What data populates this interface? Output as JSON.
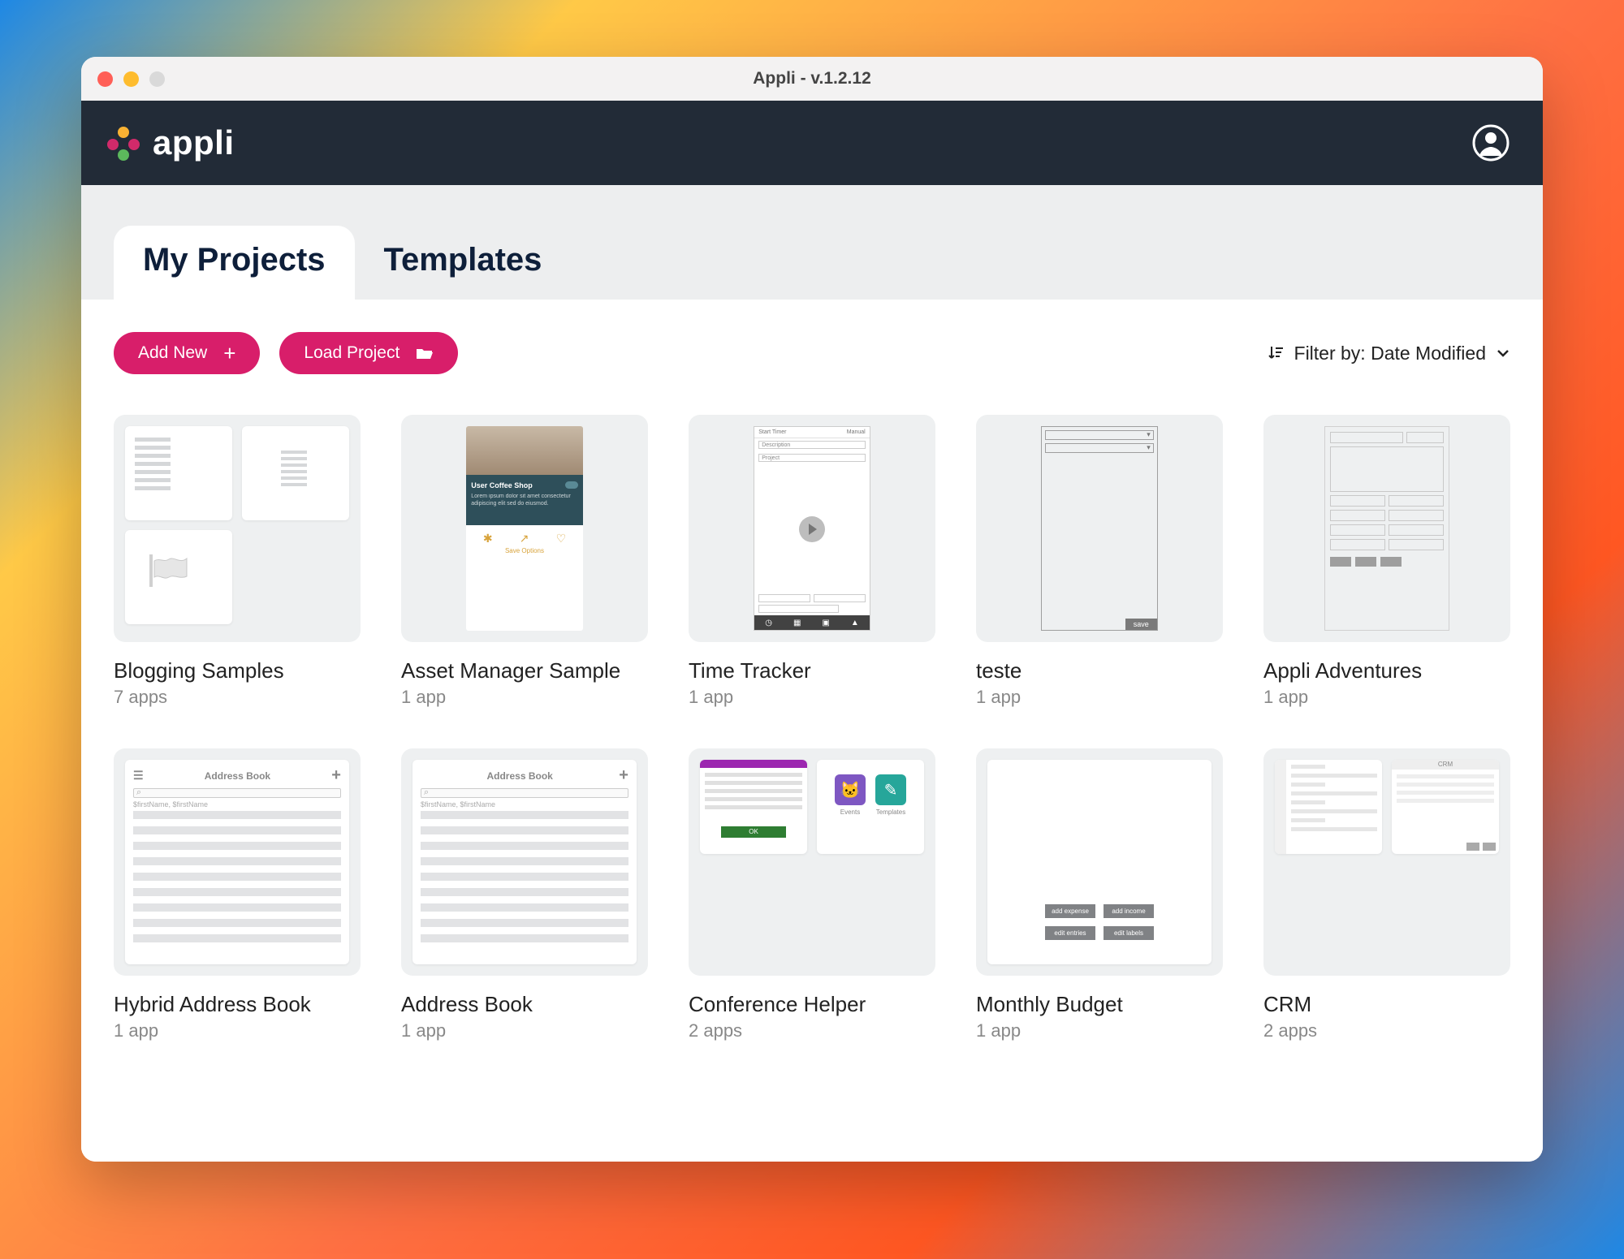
{
  "window": {
    "title": "Appli - v.1.2.12"
  },
  "brand": {
    "name": "appli"
  },
  "tabs": {
    "my_projects": "My Projects",
    "templates": "Templates"
  },
  "toolbar": {
    "add_new": "Add New",
    "load_project": "Load Project",
    "filter_label": "Filter by: Date Modified"
  },
  "thumb_text": {
    "asset_manager_title": "User Coffee Shop",
    "asset_manager_sublabel": "Save Options",
    "time_tracker_field1": "Description",
    "time_tracker_field2": "Project",
    "teste_save": "save",
    "address_book_header": "Address Book",
    "hybrid_icon": "☰",
    "conference_events": "Events",
    "conference_templates": "Templates",
    "crm_header": "CRM"
  },
  "projects": [
    {
      "title": "Blogging Samples",
      "sub": "7 apps"
    },
    {
      "title": "Asset Manager Sample",
      "sub": "1 app"
    },
    {
      "title": "Time Tracker",
      "sub": "1 app"
    },
    {
      "title": "teste",
      "sub": "1 app"
    },
    {
      "title": "Appli Adventures",
      "sub": "1 app"
    },
    {
      "title": "Hybrid Address Book",
      "sub": "1 app"
    },
    {
      "title": "Address Book",
      "sub": "1 app"
    },
    {
      "title": "Conference Helper",
      "sub": "2 apps"
    },
    {
      "title": "Monthly Budget",
      "sub": "1 app"
    },
    {
      "title": "CRM",
      "sub": "2 apps"
    }
  ]
}
